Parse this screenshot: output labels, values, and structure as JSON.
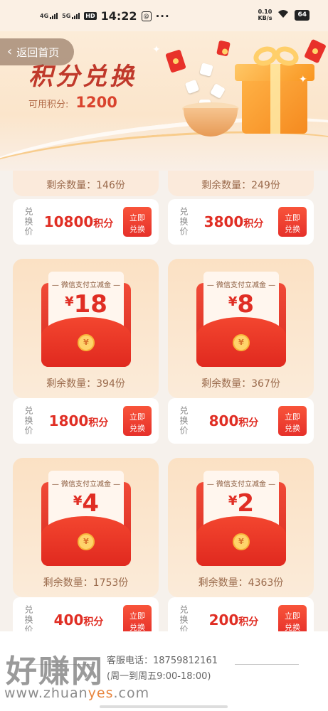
{
  "status_bar": {
    "net1": "4G",
    "net2": "5G",
    "hd": "HD",
    "time": "14:22",
    "dots": "···",
    "speed_value": "0.10",
    "speed_unit": "KB/s",
    "battery": "64"
  },
  "header": {
    "back_label": "返回首页",
    "title": "积分兑换",
    "points_label": "可用积分:",
    "points_value": "1200"
  },
  "top_partial_row": [
    {
      "remaining": "剩余数量：146份",
      "price_label": "兑换价",
      "price": "10800",
      "price_unit": "积分",
      "button": "立即兑换"
    },
    {
      "remaining": "剩余数量：249份",
      "price_label": "兑换价",
      "price": "3800",
      "price_unit": "积分",
      "button": "立即兑换"
    }
  ],
  "products": [
    {
      "tag": "微信支付立减金",
      "currency": "¥",
      "amount": "18",
      "coin": "¥",
      "remaining": "剩余数量：394份",
      "price_label": "兑换价",
      "price": "1800",
      "price_unit": "积分",
      "button": "立即兑换"
    },
    {
      "tag": "微信支付立减金",
      "currency": "¥",
      "amount": "8",
      "coin": "¥",
      "remaining": "剩余数量：367份",
      "price_label": "兑换价",
      "price": "800",
      "price_unit": "积分",
      "button": "立即兑换"
    },
    {
      "tag": "微信支付立减金",
      "currency": "¥",
      "amount": "4",
      "coin": "¥",
      "remaining": "剩余数量：1753份",
      "price_label": "兑换价",
      "price": "400",
      "price_unit": "积分",
      "button": "立即兑换"
    },
    {
      "tag": "微信支付立减金",
      "currency": "¥",
      "amount": "2",
      "coin": "¥",
      "remaining": "剩余数量：4363份",
      "price_label": "兑换价",
      "price": "200",
      "price_unit": "积分",
      "button": "立即兑换"
    }
  ],
  "footer": {
    "phone_line": "客服电话：18759812161",
    "hours_line": "(周一到周五9:00-18:00)"
  },
  "watermark": {
    "text": "好赚网",
    "url_prefix": "www.zhuan",
    "url_highlight": "yes",
    "url_suffix": ".com"
  },
  "colors": {
    "accent_red": "#e02e24",
    "banner_bg": "#fbe5cb",
    "page_bg": "#f6f1ec"
  }
}
